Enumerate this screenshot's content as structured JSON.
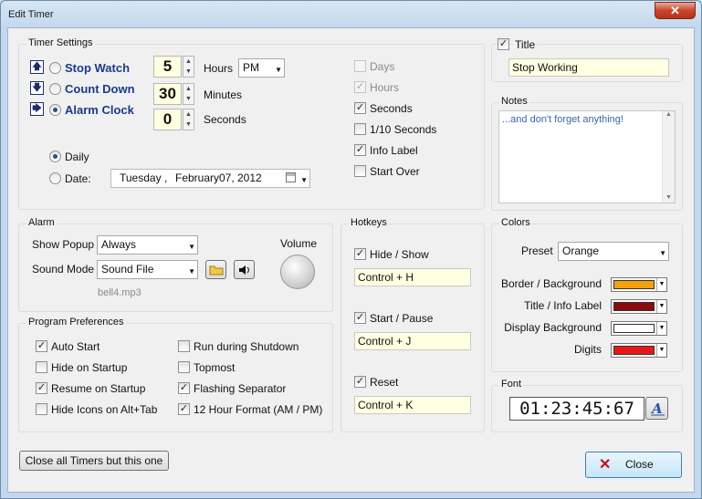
{
  "window": {
    "title": "Edit Timer",
    "close_glyph": "✕"
  },
  "timer_settings": {
    "label": "Timer Settings",
    "modes": [
      {
        "label": "Stop Watch",
        "selected": false,
        "arrow": "🡅"
      },
      {
        "label": "Count Down",
        "selected": false,
        "arrow": "🡇"
      },
      {
        "label": "Alarm Clock",
        "selected": true,
        "arrow": "🡆"
      }
    ],
    "hours": {
      "value": "5",
      "unit": "Hours"
    },
    "minutes": {
      "value": "30",
      "unit": "Minutes"
    },
    "seconds": {
      "value": "0",
      "unit": "Seconds"
    },
    "ampm": "PM",
    "daily_label": "Daily",
    "date_label": "Date:",
    "date": {
      "weekday": "Tuesday",
      "sep": ",",
      "month": "February",
      "day": "07,",
      "year": "2012"
    },
    "display_options": [
      {
        "label": "Days",
        "checked": false,
        "enabled": false
      },
      {
        "label": "Hours",
        "checked": true,
        "enabled": false
      },
      {
        "label": "Seconds",
        "checked": true,
        "enabled": true
      },
      {
        "label": "1/10 Seconds",
        "checked": false,
        "enabled": true
      },
      {
        "label": "Info Label",
        "checked": true,
        "enabled": true
      },
      {
        "label": "Start Over",
        "checked": false,
        "enabled": true
      }
    ]
  },
  "title_box": {
    "label": "Title",
    "checked": true,
    "value": "Stop Working"
  },
  "notes": {
    "label": "Notes",
    "value": "...and don't forget anything!"
  },
  "alarm": {
    "label": "Alarm",
    "show_popup_label": "Show Popup",
    "show_popup_value": "Always",
    "sound_mode_label": "Sound Mode",
    "sound_mode_value": "Sound File",
    "file": "bell4.mp3",
    "volume_label": "Volume"
  },
  "hotkeys": {
    "label": "Hotkeys",
    "items": [
      {
        "label": "Hide / Show",
        "checked": true,
        "key": "Control + H"
      },
      {
        "label": "Start / Pause",
        "checked": true,
        "key": "Control + J"
      },
      {
        "label": "Reset",
        "checked": true,
        "key": "Control + K"
      }
    ]
  },
  "colors": {
    "label": "Colors",
    "preset_label": "Preset",
    "preset_value": "Orange",
    "items": [
      {
        "label": "Border / Background",
        "color": "#f5a10c"
      },
      {
        "label": "Title / Info Label",
        "color": "#8b0b0b"
      },
      {
        "label": "Display Background",
        "color": "#ffffff"
      },
      {
        "label": "Digits",
        "color": "#e81818"
      }
    ]
  },
  "font": {
    "label": "Font",
    "preview": "01:23:45:67"
  },
  "prefs": {
    "label": "Program Preferences",
    "left": [
      {
        "label": "Auto Start",
        "checked": true
      },
      {
        "label": "Hide on Startup",
        "checked": false
      },
      {
        "label": "Resume on Startup",
        "checked": true
      },
      {
        "label": "Hide Icons on Alt+Tab",
        "checked": false
      }
    ],
    "right": [
      {
        "label": "Run during Shutdown",
        "checked": false
      },
      {
        "label": "Topmost",
        "checked": false
      },
      {
        "label": "Flashing Separator",
        "checked": true
      },
      {
        "label": "12 Hour Format (AM / PM)",
        "checked": true
      }
    ]
  },
  "buttons": {
    "close_all": "Close all Timers but this one",
    "close": "Close"
  },
  "glyphs": {
    "check": "✓",
    "up": "▲",
    "down": "▼"
  }
}
